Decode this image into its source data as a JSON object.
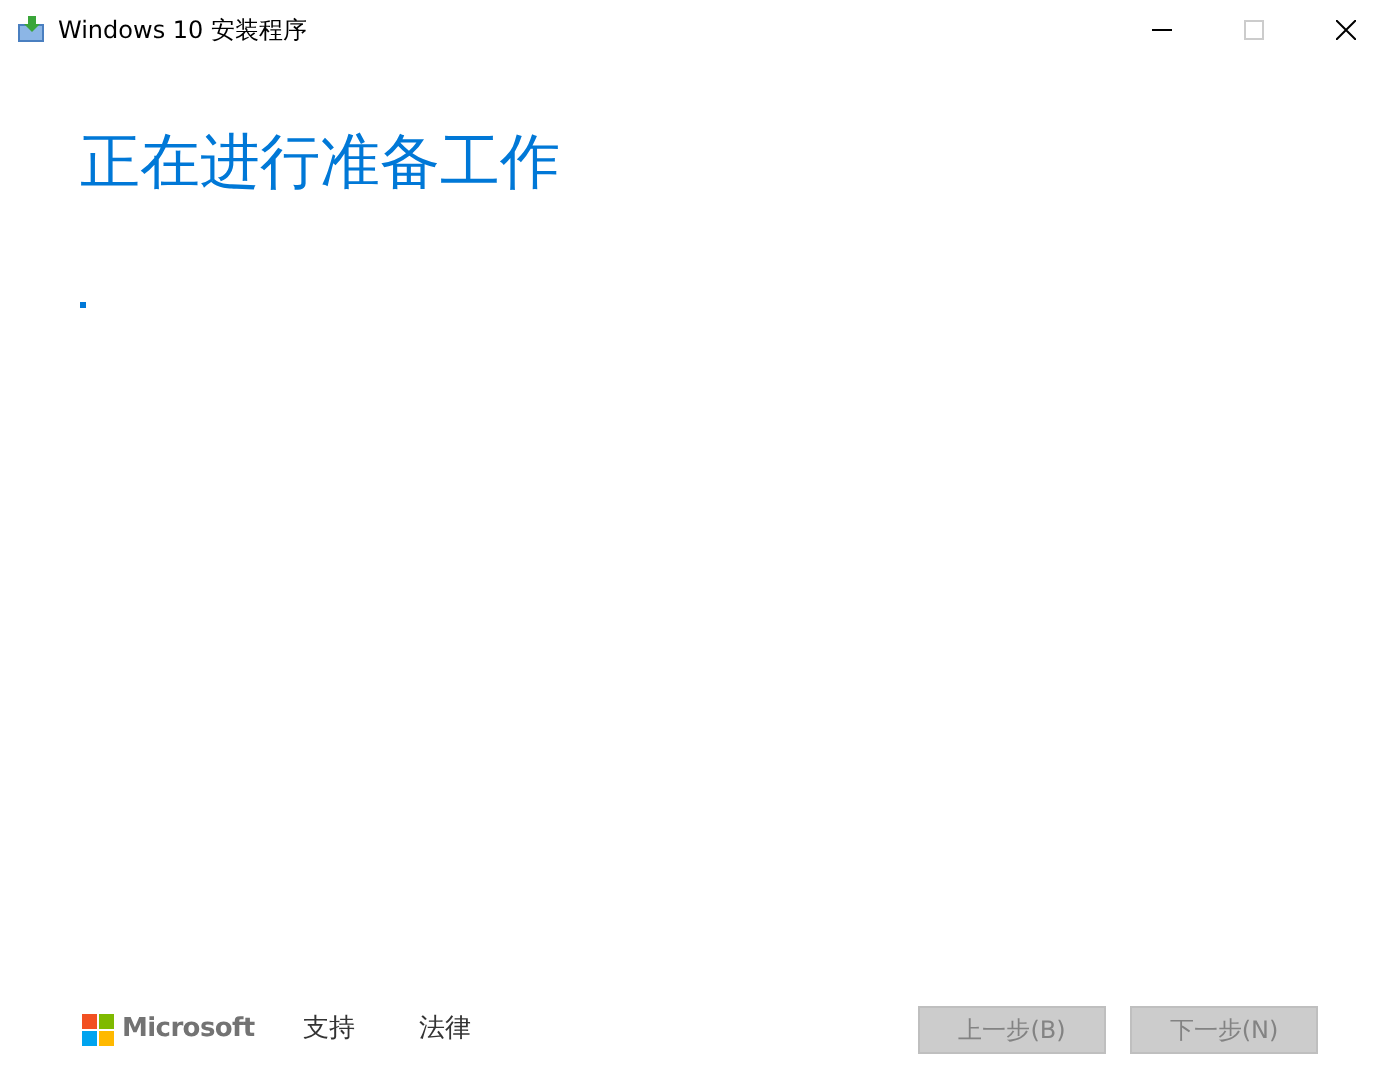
{
  "window": {
    "title": "Windows 10 安装程序",
    "controls": [
      {
        "kind": "minimize",
        "disabled": false
      },
      {
        "kind": "maximize",
        "disabled": true
      },
      {
        "kind": "close",
        "disabled": false
      }
    ]
  },
  "heading": "正在进行准备工作",
  "footer": {
    "brand": "Microsoft",
    "links": [
      "支持",
      "法律"
    ]
  },
  "buttons": [
    {
      "label": "上一步(B)",
      "disabled": true
    },
    {
      "label": "下一步(N)",
      "disabled": true
    }
  ]
}
